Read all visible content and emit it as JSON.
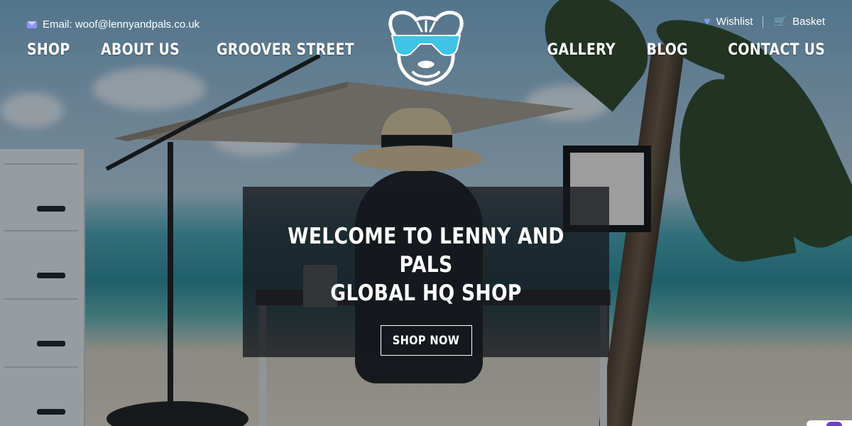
{
  "header": {
    "email_text": "Email: woof@lennyandpals.co.uk",
    "wishlist_label": "Wishlist",
    "basket_label": "Basket"
  },
  "nav": {
    "left": [
      "SHOP",
      "ABOUT US",
      "GROOVER STREET"
    ],
    "right": [
      "GALLERY",
      "BLOG",
      "CONTACT US"
    ]
  },
  "hero": {
    "title_line1": "WELCOME TO LENNY AND PALS",
    "title_line2": "GLOBAL HQ SHOP",
    "cta_label": "SHOP NOW"
  },
  "colors": {
    "accent": "#8a95f5",
    "logo_glasses": "#3fc3e6",
    "panel": "#16181c"
  },
  "icons": [
    "envelope-icon",
    "heart-icon",
    "basket-icon",
    "dog-logo"
  ]
}
